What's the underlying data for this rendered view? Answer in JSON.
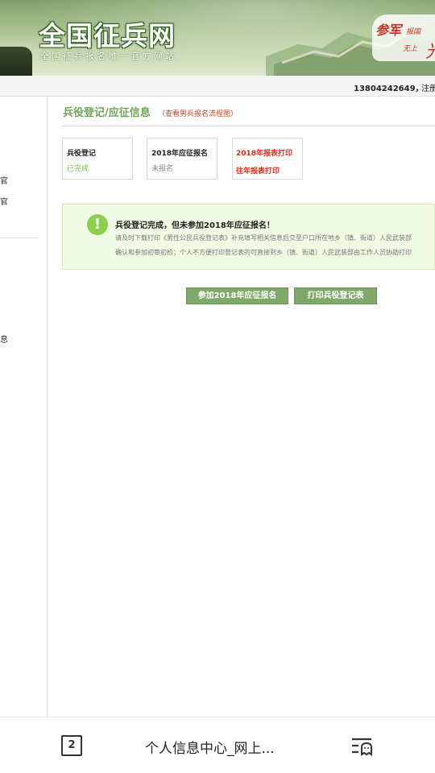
{
  "header": {
    "site_title": "全国征兵网",
    "site_subtitle": "全国征兵报名唯一官方网站",
    "slogan_a": "参军",
    "slogan_b": "报国",
    "slogan_c": "无上",
    "slogan_d": "光"
  },
  "userbar": {
    "phone": "13804242649，",
    "logout": "注册"
  },
  "sidebar": {
    "items": [
      "官",
      "官",
      "息"
    ]
  },
  "main": {
    "title": "兵役登记/应征信息",
    "title_link": "（查看男兵报名流程图）",
    "steps": [
      {
        "name": "兵役登记",
        "status": "已完成"
      },
      {
        "name": "2018年应征报名",
        "status": "未报名"
      }
    ],
    "print_links": [
      "2018年报表打印",
      "往年报表打印"
    ],
    "notice": {
      "icon": "!",
      "title": "兵役登记完成，但未参加2018年应征报名！",
      "line1": "请及时下载打印《男性公民兵役登记表》补充填写相关信息后交至户口所在地乡（镇、街道）人民武装部",
      "line2": "确认和参加初审初检；个人不方便打印登记表的可直接到乡（镇、街道）人民武装部由工作人员协助打印"
    },
    "buttons": {
      "apply": "参加2018年应征报名",
      "print": "打印兵役登记表"
    }
  },
  "browser": {
    "tab_count": "2",
    "page_name": "个人信息中心_网上..."
  },
  "colors": {
    "accent_green": "#6fa35a",
    "button_green": "#7fa96a",
    "done_green": "#7dbb5a",
    "print_red": "#e02a1a",
    "notice_bg": "#f1fae3"
  }
}
